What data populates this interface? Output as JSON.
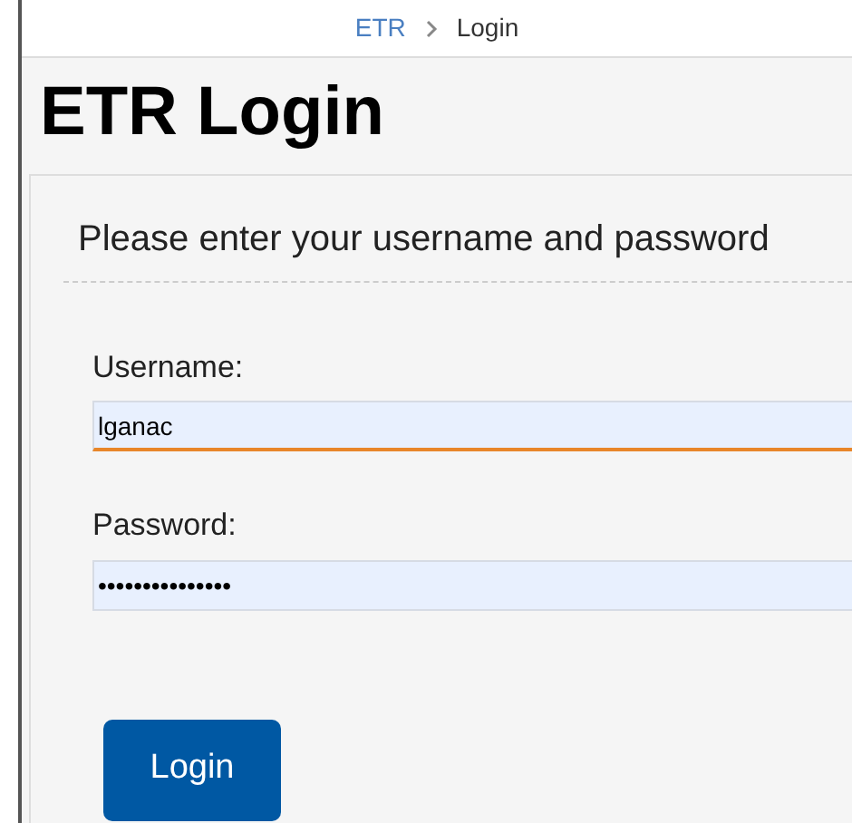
{
  "breadcrumb": [
    {
      "label": "ETR",
      "kind": "link"
    },
    {
      "label": "Login",
      "kind": "current"
    }
  ],
  "title": "ETR Login",
  "instructions": "Please enter your username and password",
  "fields": [
    {
      "label": "Username:",
      "value": "lganac",
      "focused": true
    },
    {
      "label": "Password:",
      "value": "•••••••••••••••",
      "focused": false
    }
  ],
  "button": "Login"
}
